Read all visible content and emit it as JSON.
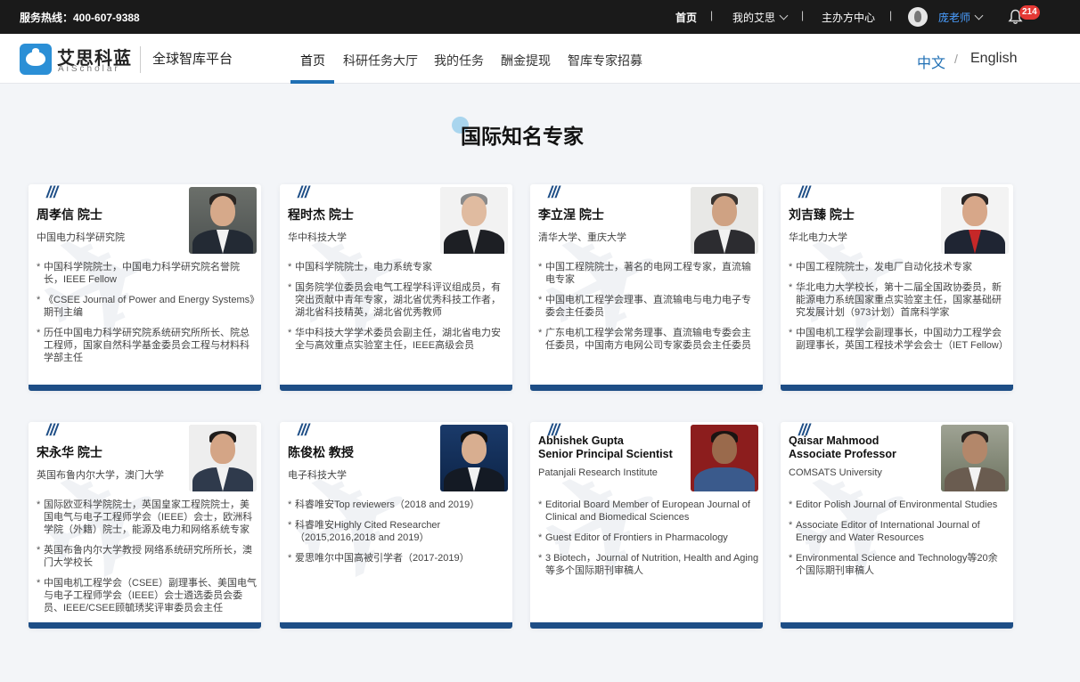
{
  "topbar": {
    "hotline": "服务热线：400-607-9388",
    "home": "首页",
    "my_aisi": "我的艾思",
    "organizer": "主办方中心",
    "username": "庞老师",
    "notification_count": "214",
    "sep1": "|",
    "sep2": "|",
    "sep3": "|"
  },
  "header": {
    "logo_cn": "艾思科蓝",
    "logo_en": "AiScholar",
    "platform": "全球智库平台",
    "nav": [
      "首页",
      "科研任务大厅",
      "我的任务",
      "酬金提现",
      "智库专家招募"
    ],
    "lang_cn": "中文",
    "lang_sep": "/",
    "lang_en": "English"
  },
  "section_title": "国际知名专家",
  "experts": [
    {
      "name": "周孝信 院士",
      "institution": "中国电力科学研究院",
      "bullets": [
        "中国科学院院士，中国电力科学研究院名誉院长，IEEE Fellow",
        "《CSEE Journal of Power and Energy Systems》期刊主编",
        "历任中国电力科学研究院系统研究所所长、院总工程师，国家自然科学基金委员会工程与材料科学部主任"
      ]
    },
    {
      "name": "程时杰 院士",
      "institution": "华中科技大学",
      "bullets": [
        "中国科学院院士，电力系统专家",
        "国务院学位委员会电气工程学科评议组成员，有突出贡献中青年专家，湖北省优秀科技工作者，湖北省科技精英，湖北省优秀教师",
        "华中科技大学学术委员会副主任，湖北省电力安全与高效重点实验室主任，IEEE高级会员"
      ]
    },
    {
      "name": "李立浧 院士",
      "institution": "清华大学、重庆大学",
      "bullets": [
        "中国工程院院士，著名的电网工程专家，直流输电专家",
        "中国电机工程学会理事、直流输电与电力电子专委会主任委员",
        "广东电机工程学会常务理事、直流输电专委会主任委员，中国南方电网公司专家委员会主任委员"
      ]
    },
    {
      "name": "刘吉臻 院士",
      "institution": "华北电力大学",
      "bullets": [
        "中国工程院院士，发电厂自动化技术专家",
        "华北电力大学校长，第十二届全国政协委员，新能源电力系统国家重点实验室主任，国家基础研究发展计划（973计划）首席科学家",
        "中国电机工程学会副理事长，中国动力工程学会副理事长，英国工程技术学会会士（IET Fellow）"
      ]
    },
    {
      "name": "宋永华 院士",
      "institution": "英国布鲁内尔大学，澳门大学",
      "bullets": [
        "国际欧亚科学院院士，英国皇家工程院院士，美国电气与电子工程师学会（IEEE）会士，欧洲科学院（外籍）院士，能源及电力和网络系统专家",
        "英国布鲁内尔大学教授 网络系统研究所所长，澳门大学校长",
        "中国电机工程学会（CSEE）副理事长、美国电气与电子工程师学会（IEEE）会士遴选委员会委员、IEEE/CSEE顾毓琇奖评审委员会主任"
      ]
    },
    {
      "name": "陈俊松 教授",
      "institution": "电子科技大学",
      "bullets": [
        "科睿唯安Top reviewers（2018 and 2019）",
        "科睿唯安Highly Cited Researcher（2015,2016,2018 and 2019）",
        "爱思唯尔中国高被引学者（2017-2019）"
      ]
    },
    {
      "name_line1": "Abhishek Gupta",
      "name_line2": "Senior Principal Scientist",
      "institution": "Patanjali Research Institute",
      "bullets": [
        "Editorial Board Member of European Journal of Clinical and Biomedical Sciences",
        "Guest Editor of Frontiers in Pharmacology",
        "3 Biotech，Journal of Nutrition, Health and Aging等多个国际期刊审稿人"
      ]
    },
    {
      "name_line1": "Qaisar Mahmood",
      "name_line2": "Associate Professor",
      "institution": "COMSATS University",
      "bullets": [
        "Editor Polish Journal of Environmental Studies",
        "Associate Editor of International Journal of Energy and Water Resources",
        "Environmental Science and Technology等20余 个国际期刊审稿人"
      ]
    }
  ],
  "colors": {
    "accent_blue": "#1e4e86",
    "link_blue": "#1f6fb4",
    "badge_red": "#e53935"
  }
}
